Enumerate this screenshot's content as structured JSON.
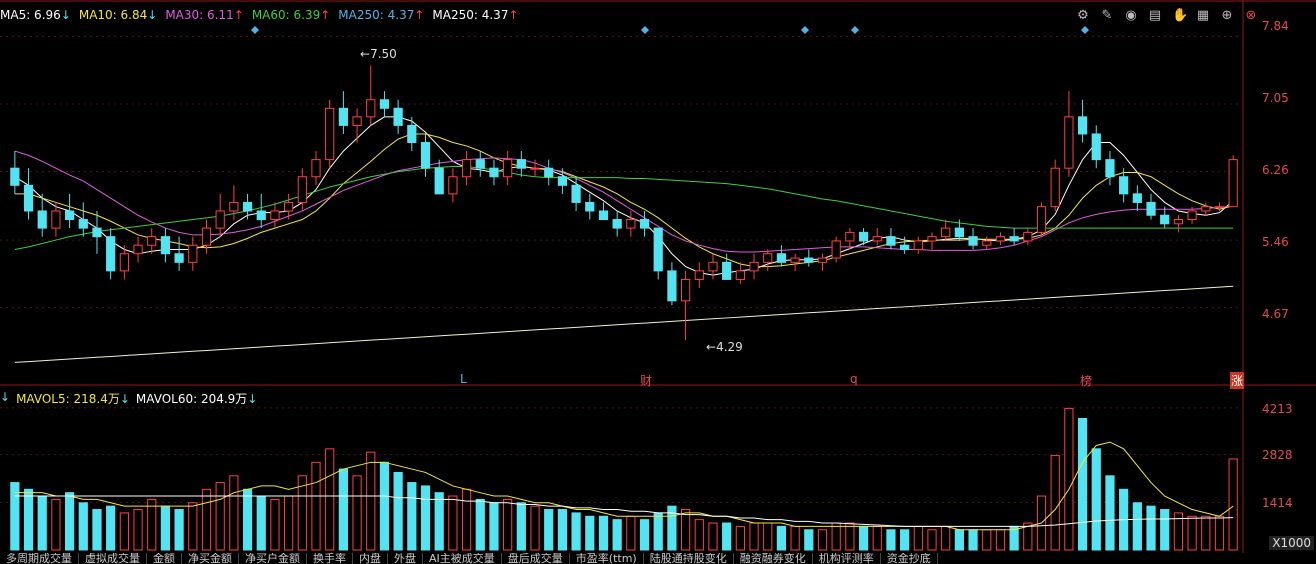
{
  "legend": {
    "ma5": {
      "text": "MA5: 6.96",
      "arrow": "↓",
      "color": "#ffffff"
    },
    "ma10": {
      "text": "MA10: 6.84",
      "arrow": "↓",
      "color": "#f5e63c"
    },
    "ma30": {
      "text": "MA30: 6.11",
      "arrow": "↑",
      "color": "#e05ce0"
    },
    "ma60": {
      "text": "MA60: 6.39",
      "arrow": "↑",
      "color": "#3ccf3c"
    },
    "ma250a": {
      "text": "MA250: 4.37",
      "arrow": "↑",
      "color": "#4fb3e8"
    },
    "ma250b": {
      "text": "MA250: 4.37",
      "arrow": "↑",
      "color": "#ffffff"
    }
  },
  "vol_legend": {
    "mavol5": {
      "text": "MAVOL5: 218.4万",
      "arrow": "↓",
      "color": "#f5e63c"
    },
    "mavol60": {
      "text": "MAVOL60: 204.9万",
      "arrow": "↓",
      "color": "#ffffff"
    }
  },
  "toolbar": {
    "icons": [
      "gear-icon",
      "pen-icon",
      "eye-icon",
      "printer-icon",
      "hand-icon",
      "calendar-icon",
      "zoom-in-icon",
      "close-icon"
    ]
  },
  "price_axis": [
    "7.84",
    "7.05",
    "6.26",
    "5.46",
    "4.67"
  ],
  "volume_axis": [
    "4213",
    "2828",
    "1414"
  ],
  "unit_label": "X1000",
  "annotations": {
    "high": "7.50",
    "low": "4.29"
  },
  "event_markers": [
    {
      "label": "L",
      "color": "#4fb3e8"
    },
    {
      "label": "财",
      "color": "#e24a4a"
    },
    {
      "label": "q",
      "color": "#e24a4a"
    },
    {
      "label": "榜",
      "color": "#e24a4a"
    },
    {
      "label": "涨",
      "color": "#ffffff"
    }
  ],
  "tabs": [
    "多周期成交量",
    "虚拟成交量",
    "金额",
    "净买金额",
    "净买户金额",
    "换手率",
    "内盘",
    "外盘",
    "AI主被成交量",
    "盘后成交量",
    "市盈率(ttm)",
    "陆股通持股变化",
    "融资融券变化",
    "机构评测率",
    "资金抄底"
  ],
  "colors": {
    "up": "#ff4040",
    "down": "#54e3f0",
    "ma5": "#ffffff",
    "ma10": "#f5e63c",
    "ma30": "#e05ce0",
    "ma60": "#3ccf3c",
    "ma250": "#f0f0d0",
    "axis": "#e24a4a"
  },
  "chart_data": {
    "type": "candlestick",
    "y_range": [
      4.29,
      7.84
    ],
    "candles": [
      [
        6.3,
        6.5,
        6.0,
        6.1
      ],
      [
        6.1,
        6.3,
        5.7,
        5.8
      ],
      [
        5.8,
        6.0,
        5.5,
        5.6
      ],
      [
        5.6,
        5.9,
        5.5,
        5.8
      ],
      [
        5.8,
        6.0,
        5.6,
        5.7
      ],
      [
        5.7,
        5.9,
        5.5,
        5.6
      ],
      [
        5.6,
        5.8,
        5.3,
        5.5
      ],
      [
        5.5,
        5.6,
        5.0,
        5.1
      ],
      [
        5.1,
        5.4,
        5.0,
        5.3
      ],
      [
        5.3,
        5.5,
        5.2,
        5.4
      ],
      [
        5.4,
        5.6,
        5.3,
        5.5
      ],
      [
        5.5,
        5.6,
        5.2,
        5.3
      ],
      [
        5.3,
        5.5,
        5.1,
        5.2
      ],
      [
        5.2,
        5.5,
        5.1,
        5.4
      ],
      [
        5.4,
        5.7,
        5.3,
        5.6
      ],
      [
        5.6,
        6.0,
        5.5,
        5.8
      ],
      [
        5.8,
        6.1,
        5.7,
        5.9
      ],
      [
        5.9,
        6.0,
        5.7,
        5.8
      ],
      [
        5.8,
        6.0,
        5.6,
        5.7
      ],
      [
        5.7,
        5.9,
        5.6,
        5.8
      ],
      [
        5.8,
        6.0,
        5.7,
        5.9
      ],
      [
        5.9,
        6.3,
        5.8,
        6.2
      ],
      [
        6.2,
        6.5,
        6.1,
        6.4
      ],
      [
        6.4,
        7.1,
        6.3,
        7.0
      ],
      [
        7.0,
        7.2,
        6.7,
        6.8
      ],
      [
        6.8,
        7.0,
        6.6,
        6.9
      ],
      [
        6.9,
        7.5,
        6.8,
        7.1
      ],
      [
        7.1,
        7.2,
        6.9,
        7.0
      ],
      [
        7.0,
        7.1,
        6.7,
        6.8
      ],
      [
        6.8,
        6.9,
        6.5,
        6.6
      ],
      [
        6.6,
        6.7,
        6.2,
        6.3
      ],
      [
        6.3,
        6.4,
        6.0,
        6.0
      ],
      [
        6.0,
        6.3,
        5.9,
        6.2
      ],
      [
        6.2,
        6.5,
        6.1,
        6.4
      ],
      [
        6.4,
        6.5,
        6.2,
        6.3
      ],
      [
        6.3,
        6.4,
        6.1,
        6.2
      ],
      [
        6.2,
        6.5,
        6.1,
        6.4
      ],
      [
        6.4,
        6.5,
        6.2,
        6.3
      ],
      [
        6.3,
        6.4,
        6.2,
        6.3
      ],
      [
        6.3,
        6.4,
        6.1,
        6.2
      ],
      [
        6.2,
        6.3,
        6.0,
        6.1
      ],
      [
        6.1,
        6.2,
        5.8,
        5.9
      ],
      [
        5.9,
        6.0,
        5.7,
        5.8
      ],
      [
        5.8,
        5.9,
        5.7,
        5.7
      ],
      [
        5.7,
        5.8,
        5.5,
        5.6
      ],
      [
        5.6,
        5.8,
        5.5,
        5.7
      ],
      [
        5.7,
        5.8,
        5.5,
        5.6
      ],
      [
        5.6,
        5.6,
        5.0,
        5.1
      ],
      [
        5.1,
        5.2,
        4.7,
        4.75
      ],
      [
        4.75,
        5.1,
        4.29,
        5.0
      ],
      [
        5.0,
        5.2,
        4.9,
        5.1
      ],
      [
        5.1,
        5.3,
        5.0,
        5.2
      ],
      [
        5.2,
        5.3,
        5.0,
        5.0
      ],
      [
        5.0,
        5.2,
        4.95,
        5.1
      ],
      [
        5.1,
        5.3,
        5.0,
        5.2
      ],
      [
        5.2,
        5.35,
        5.1,
        5.3
      ],
      [
        5.3,
        5.4,
        5.15,
        5.2
      ],
      [
        5.2,
        5.3,
        5.1,
        5.25
      ],
      [
        5.25,
        5.35,
        5.15,
        5.2
      ],
      [
        5.2,
        5.3,
        5.1,
        5.25
      ],
      [
        5.25,
        5.5,
        5.2,
        5.45
      ],
      [
        5.45,
        5.6,
        5.35,
        5.55
      ],
      [
        5.55,
        5.6,
        5.4,
        5.45
      ],
      [
        5.45,
        5.6,
        5.4,
        5.5
      ],
      [
        5.5,
        5.6,
        5.35,
        5.4
      ],
      [
        5.4,
        5.5,
        5.3,
        5.35
      ],
      [
        5.35,
        5.5,
        5.3,
        5.45
      ],
      [
        5.45,
        5.55,
        5.35,
        5.5
      ],
      [
        5.5,
        5.7,
        5.45,
        5.6
      ],
      [
        5.6,
        5.7,
        5.45,
        5.5
      ],
      [
        5.5,
        5.6,
        5.35,
        5.4
      ],
      [
        5.4,
        5.5,
        5.35,
        5.45
      ],
      [
        5.45,
        5.55,
        5.4,
        5.5
      ],
      [
        5.5,
        5.6,
        5.4,
        5.45
      ],
      [
        5.45,
        5.6,
        5.4,
        5.55
      ],
      [
        5.55,
        5.9,
        5.5,
        5.85
      ],
      [
        5.85,
        6.4,
        5.8,
        6.3
      ],
      [
        6.3,
        7.2,
        6.2,
        6.9
      ],
      [
        6.9,
        7.1,
        6.6,
        6.7
      ],
      [
        6.7,
        6.8,
        6.3,
        6.4
      ],
      [
        6.4,
        6.5,
        6.1,
        6.2
      ],
      [
        6.2,
        6.3,
        5.9,
        6.0
      ],
      [
        6.0,
        6.1,
        5.8,
        5.9
      ],
      [
        5.9,
        6.0,
        5.7,
        5.75
      ],
      [
        5.75,
        5.85,
        5.6,
        5.65
      ],
      [
        5.65,
        5.75,
        5.55,
        5.7
      ],
      [
        5.7,
        5.85,
        5.65,
        5.8
      ],
      [
        5.8,
        5.9,
        5.75,
        5.85
      ],
      [
        5.85,
        5.9,
        5.8,
        5.85
      ],
      [
        5.85,
        6.45,
        5.85,
        6.4
      ]
    ],
    "volume": [
      2.0,
      1.8,
      1.6,
      1.5,
      1.7,
      1.4,
      1.2,
      1.3,
      1.1,
      1.2,
      1.5,
      1.3,
      1.2,
      1.4,
      1.8,
      2.0,
      2.2,
      1.8,
      1.6,
      1.5,
      1.6,
      2.2,
      2.6,
      3.0,
      2.4,
      2.2,
      2.9,
      2.6,
      2.3,
      2.0,
      1.9,
      1.7,
      1.6,
      1.8,
      1.5,
      1.4,
      1.5,
      1.4,
      1.3,
      1.2,
      1.2,
      1.1,
      1.0,
      1.0,
      0.9,
      1.0,
      0.9,
      1.1,
      1.3,
      1.2,
      0.9,
      0.8,
      0.8,
      0.7,
      0.8,
      0.8,
      0.7,
      0.7,
      0.6,
      0.6,
      0.8,
      0.8,
      0.7,
      0.7,
      0.6,
      0.6,
      0.7,
      0.6,
      0.7,
      0.6,
      0.6,
      0.6,
      0.6,
      0.7,
      0.8,
      1.6,
      2.8,
      4.2,
      3.9,
      3.0,
      2.2,
      1.8,
      1.4,
      1.3,
      1.2,
      1.1,
      1.0,
      1.0,
      1.0,
      2.7
    ],
    "ma_series": {
      "ma5": [
        6.2,
        6.1,
        5.95,
        5.85,
        5.8,
        5.7,
        5.6,
        5.45,
        5.35,
        5.3,
        5.33,
        5.35,
        5.35,
        5.35,
        5.4,
        5.5,
        5.65,
        5.75,
        5.78,
        5.78,
        5.8,
        5.9,
        6.05,
        6.3,
        6.5,
        6.65,
        6.8,
        6.9,
        6.9,
        6.85,
        6.72,
        6.55,
        6.38,
        6.3,
        6.28,
        6.25,
        6.3,
        6.32,
        6.3,
        6.28,
        6.22,
        6.12,
        6.02,
        5.92,
        5.8,
        5.72,
        5.66,
        5.5,
        5.3,
        5.15,
        5.08,
        5.05,
        5.08,
        5.1,
        5.12,
        5.18,
        5.22,
        5.23,
        5.23,
        5.24,
        5.3,
        5.36,
        5.42,
        5.48,
        5.5,
        5.46,
        5.44,
        5.45,
        5.47,
        5.48,
        5.48,
        5.46,
        5.45,
        5.47,
        5.5,
        5.58,
        5.76,
        6.1,
        6.4,
        6.6,
        6.6,
        6.45,
        6.25,
        6.05,
        5.9,
        5.8,
        5.77,
        5.75,
        5.78,
        5.92
      ],
      "ma10": [
        6.0,
        6.0,
        5.95,
        5.9,
        5.85,
        5.8,
        5.75,
        5.68,
        5.6,
        5.52,
        5.48,
        5.45,
        5.42,
        5.38,
        5.37,
        5.38,
        5.42,
        5.48,
        5.55,
        5.6,
        5.65,
        5.7,
        5.8,
        5.95,
        6.12,
        6.25,
        6.38,
        6.52,
        6.64,
        6.7,
        6.7,
        6.66,
        6.6,
        6.56,
        6.5,
        6.42,
        6.36,
        6.32,
        6.3,
        6.29,
        6.26,
        6.2,
        6.14,
        6.08,
        6.0,
        5.9,
        5.82,
        5.72,
        5.6,
        5.48,
        5.38,
        5.3,
        5.24,
        5.18,
        5.15,
        5.15,
        5.16,
        5.18,
        5.2,
        5.22,
        5.26,
        5.3,
        5.34,
        5.38,
        5.42,
        5.44,
        5.45,
        5.46,
        5.46,
        5.46,
        5.47,
        5.47,
        5.47,
        5.47,
        5.48,
        5.52,
        5.6,
        5.75,
        5.95,
        6.1,
        6.2,
        6.25,
        6.25,
        6.2,
        6.1,
        6.0,
        5.92,
        5.86,
        5.82,
        5.86
      ],
      "ma30": [
        6.5,
        6.45,
        6.38,
        6.3,
        6.22,
        6.15,
        6.05,
        5.95,
        5.85,
        5.75,
        5.67,
        5.6,
        5.55,
        5.52,
        5.52,
        5.53,
        5.55,
        5.58,
        5.62,
        5.68,
        5.74,
        5.8,
        5.88,
        5.96,
        6.04,
        6.1,
        6.16,
        6.22,
        6.27,
        6.3,
        6.33,
        6.36,
        6.38,
        6.4,
        6.41,
        6.42,
        6.41,
        6.4,
        6.36,
        6.3,
        6.25,
        6.18,
        6.1,
        6.02,
        5.92,
        5.82,
        5.72,
        5.62,
        5.52,
        5.45,
        5.4,
        5.36,
        5.33,
        5.32,
        5.32,
        5.33,
        5.34,
        5.35,
        5.36,
        5.37,
        5.38,
        5.38,
        5.38,
        5.37,
        5.36,
        5.35,
        5.35,
        5.34,
        5.34,
        5.34,
        5.34,
        5.35,
        5.37,
        5.4,
        5.45,
        5.5,
        5.58,
        5.66,
        5.72,
        5.76,
        5.79,
        5.81,
        5.82,
        5.82,
        5.82,
        5.82,
        5.82,
        5.83,
        5.84,
        5.86
      ],
      "ma60": [
        5.35,
        5.38,
        5.42,
        5.46,
        5.5,
        5.53,
        5.56,
        5.58,
        5.6,
        5.62,
        5.64,
        5.66,
        5.68,
        5.7,
        5.72,
        5.74,
        5.77,
        5.8,
        5.84,
        5.88,
        5.93,
        5.98,
        6.03,
        6.08,
        6.12,
        6.16,
        6.2,
        6.23,
        6.26,
        6.28,
        6.3,
        6.31,
        6.32,
        6.32,
        6.3,
        6.28,
        6.25,
        6.22,
        6.2,
        6.19,
        6.19,
        6.19,
        6.19,
        6.19,
        6.19,
        6.18,
        6.18,
        6.17,
        6.16,
        6.15,
        6.14,
        6.13,
        6.12,
        6.1,
        6.08,
        6.06,
        6.03,
        6.0,
        5.97,
        5.94,
        5.92,
        5.89,
        5.86,
        5.83,
        5.8,
        5.77,
        5.74,
        5.71,
        5.68,
        5.66,
        5.64,
        5.62,
        5.61,
        5.6,
        5.6,
        5.6,
        5.6,
        5.6,
        5.6,
        5.6,
        5.6,
        5.6,
        5.6,
        5.6,
        5.6,
        5.6,
        5.6,
        5.6,
        5.6,
        5.6
      ],
      "ma250": [
        4.03,
        4.04,
        4.05,
        4.06,
        4.07,
        4.08,
        4.09,
        4.1,
        4.11,
        4.12,
        4.13,
        4.14,
        4.15,
        4.16,
        4.17,
        4.18,
        4.19,
        4.2,
        4.21,
        4.22,
        4.23,
        4.24,
        4.25,
        4.26,
        4.27,
        4.28,
        4.29,
        4.3,
        4.31,
        4.32,
        4.33,
        4.34,
        4.35,
        4.36,
        4.37,
        4.38,
        4.39,
        4.4,
        4.41,
        4.42,
        4.43,
        4.44,
        4.45,
        4.46,
        4.47,
        4.48,
        4.49,
        4.5,
        4.51,
        4.52,
        4.53,
        4.54,
        4.55,
        4.56,
        4.57,
        4.58,
        4.59,
        4.6,
        4.61,
        4.62,
        4.63,
        4.64,
        4.65,
        4.66,
        4.67,
        4.68,
        4.69,
        4.7,
        4.71,
        4.72,
        4.73,
        4.74,
        4.75,
        4.76,
        4.77,
        4.78,
        4.79,
        4.8,
        4.81,
        4.82,
        4.83,
        4.84,
        4.85,
        4.86,
        4.87,
        4.88,
        4.89,
        4.9,
        4.91,
        4.92
      ]
    },
    "mavol5": [
      1.7,
      1.7,
      1.7,
      1.6,
      1.6,
      1.5,
      1.5,
      1.4,
      1.3,
      1.3,
      1.3,
      1.3,
      1.3,
      1.3,
      1.4,
      1.5,
      1.7,
      1.8,
      1.9,
      1.9,
      1.8,
      1.9,
      2.0,
      2.2,
      2.4,
      2.5,
      2.6,
      2.6,
      2.5,
      2.4,
      2.3,
      2.1,
      1.9,
      1.8,
      1.7,
      1.6,
      1.6,
      1.5,
      1.4,
      1.4,
      1.3,
      1.2,
      1.2,
      1.1,
      1.0,
      1.0,
      1.0,
      1.0,
      1.0,
      1.1,
      1.1,
      1.0,
      1.0,
      0.9,
      0.8,
      0.8,
      0.8,
      0.7,
      0.7,
      0.7,
      0.7,
      0.7,
      0.7,
      0.7,
      0.7,
      0.7,
      0.7,
      0.7,
      0.7,
      0.6,
      0.6,
      0.6,
      0.6,
      0.6,
      0.7,
      0.8,
      1.2,
      1.8,
      2.6,
      3.1,
      3.2,
      3.0,
      2.5,
      2.0,
      1.6,
      1.4,
      1.2,
      1.1,
      1.0,
      1.3
    ],
    "mavol60": [
      1.6,
      1.6,
      1.6,
      1.6,
      1.6,
      1.6,
      1.6,
      1.6,
      1.6,
      1.6,
      1.6,
      1.6,
      1.6,
      1.6,
      1.6,
      1.6,
      1.6,
      1.6,
      1.6,
      1.6,
      1.6,
      1.6,
      1.6,
      1.6,
      1.6,
      1.6,
      1.6,
      1.6,
      1.55,
      1.55,
      1.5,
      1.5,
      1.5,
      1.45,
      1.45,
      1.4,
      1.4,
      1.35,
      1.35,
      1.3,
      1.3,
      1.25,
      1.25,
      1.2,
      1.2,
      1.15,
      1.15,
      1.1,
      1.1,
      1.05,
      1.05,
      1.0,
      1.0,
      0.95,
      0.95,
      0.9,
      0.9,
      0.85,
      0.85,
      0.8,
      0.8,
      0.78,
      0.76,
      0.74,
      0.72,
      0.7,
      0.7,
      0.7,
      0.7,
      0.7,
      0.7,
      0.7,
      0.7,
      0.7,
      0.7,
      0.72,
      0.74,
      0.78,
      0.82,
      0.86,
      0.88,
      0.9,
      0.91,
      0.92,
      0.92,
      0.93,
      0.94,
      0.95,
      0.95,
      0.96
    ]
  }
}
